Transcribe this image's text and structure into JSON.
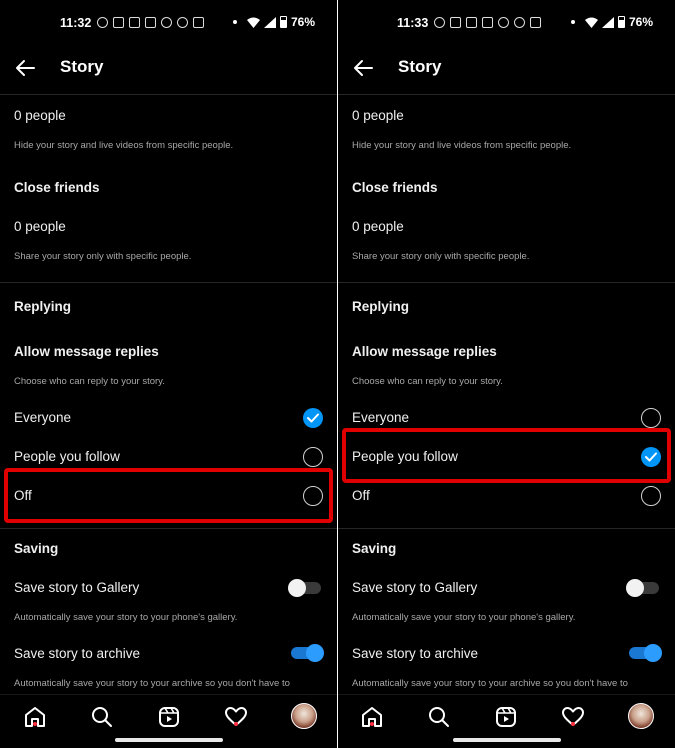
{
  "screens": [
    {
      "status": {
        "time": "11:32",
        "battery": "76%"
      },
      "header": {
        "title": "Story"
      },
      "hide": {
        "people": "0 people",
        "desc": "Hide your story and live videos from specific people."
      },
      "close_friends": {
        "label": "Close friends",
        "people": "0 people",
        "desc": "Share your story only with specific people."
      },
      "replying": {
        "section": "Replying",
        "allow_label": "Allow message replies",
        "desc": "Choose who can reply to your story.",
        "options": [
          {
            "label": "Everyone",
            "selected": true
          },
          {
            "label": "People you follow",
            "selected": false
          },
          {
            "label": "Off",
            "selected": false
          }
        ]
      },
      "saving": {
        "section": "Saving",
        "gallery_label": "Save story to Gallery",
        "gallery_desc": "Automatically save your story to your phone's gallery.",
        "gallery_on": false,
        "archive_label": "Save story to archive",
        "archive_desc": "Automatically save your story to your archive so you don't have to",
        "archive_on": true
      },
      "highlighted_option": "Off"
    },
    {
      "status": {
        "time": "11:33",
        "battery": "76%"
      },
      "header": {
        "title": "Story"
      },
      "hide": {
        "people": "0 people",
        "desc": "Hide your story and live videos from specific people."
      },
      "close_friends": {
        "label": "Close friends",
        "people": "0 people",
        "desc": "Share your story only with specific people."
      },
      "replying": {
        "section": "Replying",
        "allow_label": "Allow message replies",
        "desc": "Choose who can reply to your story.",
        "options": [
          {
            "label": "Everyone",
            "selected": false
          },
          {
            "label": "People you follow",
            "selected": true
          },
          {
            "label": "Off",
            "selected": false
          }
        ]
      },
      "saving": {
        "section": "Saving",
        "gallery_label": "Save story to Gallery",
        "gallery_desc": "Automatically save your story to your phone's gallery.",
        "gallery_on": false,
        "archive_label": "Save story to archive",
        "archive_desc": "Automatically save your story to your archive so you don't have to",
        "archive_on": true
      },
      "highlighted_option": "People you follow"
    }
  ],
  "nav": {
    "items": [
      "home-icon",
      "search-icon",
      "reels-icon",
      "heart-icon",
      "profile-avatar"
    ]
  },
  "colors": {
    "background": "#000000",
    "accent": "#0095f6",
    "highlight": "#e00000",
    "toggle_on": "#1a77d2"
  }
}
